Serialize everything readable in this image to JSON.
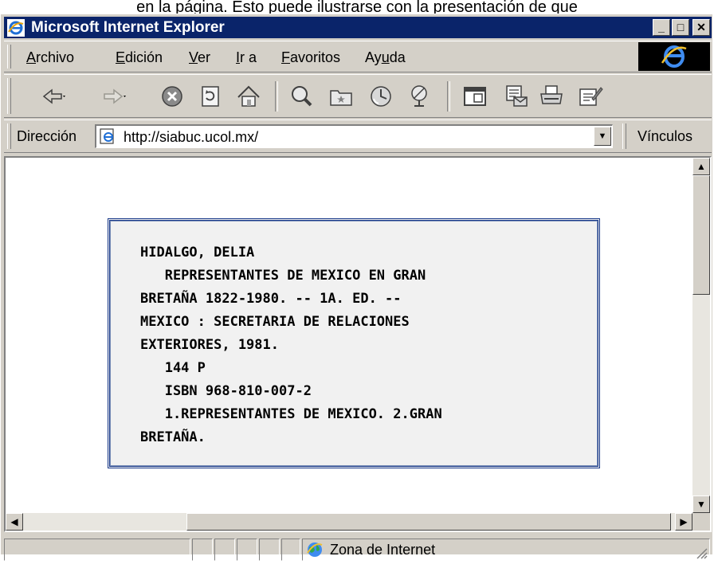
{
  "caption": "en la página. Esto puede ilustrarse con la presentación de que",
  "window": {
    "title": "Microsoft Internet Explorer",
    "controls": {
      "minimize": "_",
      "maximize": "□",
      "close": "✕"
    }
  },
  "menu": {
    "items": [
      {
        "pre": "",
        "u": "A",
        "post": "rchivo"
      },
      {
        "pre": "",
        "u": "E",
        "post": "dición"
      },
      {
        "pre": "",
        "u": "V",
        "post": "er"
      },
      {
        "pre": "",
        "u": "I",
        "post": "r a"
      },
      {
        "pre": "",
        "u": "F",
        "post": "avoritos"
      },
      {
        "pre": "Ay",
        "u": "u",
        "post": "da"
      }
    ]
  },
  "toolbar": {
    "icons": [
      "back-icon",
      "forward-icon",
      "stop-icon",
      "refresh-icon",
      "home-icon",
      "search-icon",
      "favorites-icon",
      "history-icon",
      "channels-icon",
      "fullscreen-icon",
      "mail-icon",
      "print-icon",
      "edit-icon"
    ]
  },
  "address": {
    "label": "Dirección",
    "url": "http://siabuc.ucol.mx/",
    "links_label": "Vínculos"
  },
  "record": {
    "lines": [
      "HIDALGO, DELIA",
      "   REPRESENTANTES DE MEXICO EN GRAN",
      "BRETAÑA 1822-1980. -- 1A. ED. --",
      "MEXICO : SECRETARIA DE RELACIONES",
      "EXTERIORES, 1981.",
      "   144 P",
      "   ISBN 968-810-007-2",
      "   1.REPRESENTANTES DE MEXICO. 2.GRAN",
      "BRETAÑA."
    ]
  },
  "status": {
    "zone": "Zona de Internet"
  },
  "colors": {
    "titlebar": "#0a246a",
    "chrome": "#d4d0c8",
    "card_border": "#1a3a8a",
    "card_bg": "#f1f1f1"
  }
}
